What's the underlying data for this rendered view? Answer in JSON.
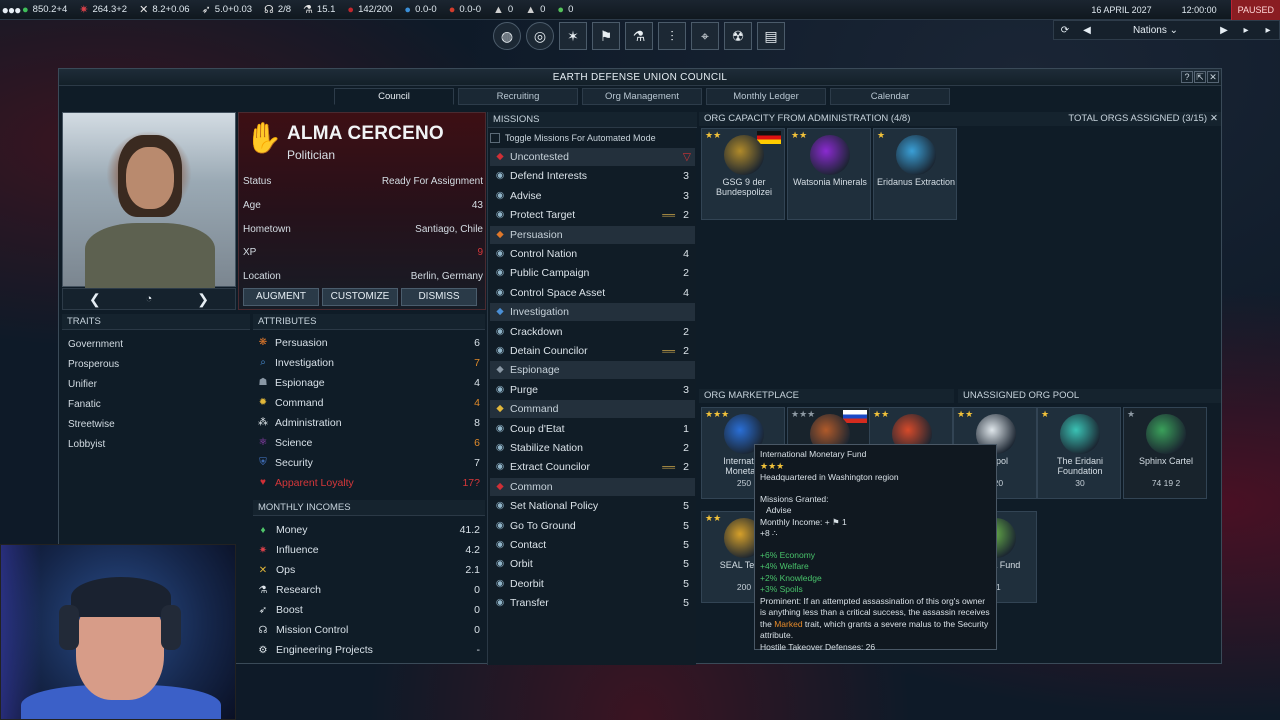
{
  "topbar": {
    "resources": [
      {
        "icon": "money-icon",
        "value": "850.2+4",
        "color": "#3fbf5a"
      },
      {
        "icon": "influence-icon",
        "value": "264.3+2",
        "color": "#d9414a"
      },
      {
        "icon": "ops-icon",
        "value": "8.2+0.06",
        "color": "#e6e6e6"
      },
      {
        "icon": "boost-icon",
        "value": "5.0+0.03",
        "color": "#e6e6e6"
      },
      {
        "icon": "mission-control-icon",
        "value": "2/8",
        "color": "#e6e6e6"
      },
      {
        "icon": "research-icon",
        "value": "15.1",
        "color": "#e6e6e6"
      },
      {
        "icon": "control-points-icon",
        "value": "142/200",
        "color": "#c0272d"
      },
      {
        "icon": "water-icon",
        "value": "0.0-0",
        "color": "#3a8fd8"
      },
      {
        "icon": "volatiles-icon",
        "value": "0.0-0",
        "color": "#d23c2c"
      },
      {
        "icon": "metals-icon",
        "value": "0",
        "color": "#cfcfcf"
      },
      {
        "icon": "noble-metals-icon",
        "value": "0",
        "color": "#cfcfcf"
      },
      {
        "icon": "fissiles-icon",
        "value": "0",
        "color": "#54c25a"
      }
    ],
    "date": "16 APRIL 2027",
    "time": "12:00:00",
    "paused": "PAUSED",
    "nations_select": "Nations"
  },
  "panel": {
    "title": "EARTH DEFENSE UNION COUNCIL",
    "tabs": [
      "Council",
      "Recruiting",
      "Org Management",
      "Monthly Ledger",
      "Calendar"
    ]
  },
  "councilor": {
    "name": "ALMA CERCENO",
    "role": "Politician",
    "info": [
      {
        "label": "Status",
        "value": "Ready For Assignment"
      },
      {
        "label": "Age",
        "value": "43"
      },
      {
        "label": "Hometown",
        "value": "Santiago, Chile"
      },
      {
        "label": "XP",
        "value": "9"
      },
      {
        "label": "Location",
        "value": "Berlin, Germany"
      }
    ],
    "buttons": {
      "augment": "AUGMENT",
      "customize": "CUSTOMIZE",
      "dismiss": "DISMISS"
    }
  },
  "traits": {
    "header": "TRAITS",
    "items": [
      "Government",
      "Prosperous",
      "Unifier",
      "Fanatic",
      "Streetwise",
      "Lobbyist"
    ]
  },
  "attributes": {
    "header": "ATTRIBUTES",
    "items": [
      {
        "name": "Persuasion",
        "value": "6",
        "icon": "persuasion-icon",
        "color": "#e0782a"
      },
      {
        "name": "Investigation",
        "value": "7",
        "icon": "investigation-icon",
        "color": "#4a8fd6"
      },
      {
        "name": "Espionage",
        "value": "4",
        "icon": "espionage-icon",
        "color": "#8a98a5"
      },
      {
        "name": "Command",
        "value": "4",
        "icon": "command-icon",
        "color": "#e2b73a"
      },
      {
        "name": "Administration",
        "value": "8",
        "icon": "administration-icon",
        "color": "#dfe6eb"
      },
      {
        "name": "Science",
        "value": "6",
        "icon": "science-icon",
        "color": "#b44ad6"
      },
      {
        "name": "Security",
        "value": "7",
        "icon": "security-icon",
        "color": "#4a7fd6"
      },
      {
        "name": "Apparent Loyalty",
        "value": "17?",
        "icon": "loyalty-icon",
        "color": "#d12f36"
      }
    ]
  },
  "incomes": {
    "header": "MONTHLY INCOMES",
    "items": [
      {
        "name": "Money",
        "value": "41.2",
        "icon": "money-icon",
        "color": "#4fc46a"
      },
      {
        "name": "Influence",
        "value": "4.2",
        "icon": "influence-icon",
        "color": "#d9414a"
      },
      {
        "name": "Ops",
        "value": "2.1",
        "icon": "ops-icon",
        "color": "#e2b73a"
      },
      {
        "name": "Research",
        "value": "0",
        "icon": "research-icon",
        "color": "#dfe6eb"
      },
      {
        "name": "Boost",
        "value": "0",
        "icon": "boost-icon",
        "color": "#dfe6eb"
      },
      {
        "name": "Mission Control",
        "value": "0",
        "icon": "mission-control-icon",
        "color": "#dfe6eb"
      },
      {
        "name": "Engineering Projects",
        "value": "-",
        "icon": "engineering-icon",
        "color": "#dfe6eb"
      }
    ]
  },
  "missions": {
    "header": "MISSIONS",
    "toggle": "Toggle Missions For Automated Mode",
    "rows": [
      {
        "type": "cat",
        "name": "Uncontested",
        "icon": "uncontested-icon",
        "color": "#d12f36"
      },
      {
        "type": "item",
        "name": "Defend Interests",
        "value": "3",
        "icon": "defend-interests-icon"
      },
      {
        "type": "item",
        "name": "Advise",
        "value": "3",
        "icon": "advise-icon"
      },
      {
        "type": "item",
        "name": "Protect Target",
        "value": "2",
        "icon": "protect-target-icon",
        "extra": "══"
      },
      {
        "type": "cat",
        "name": "Persuasion",
        "icon": "persuasion-icon",
        "color": "#e0782a"
      },
      {
        "type": "item",
        "name": "Control Nation",
        "value": "4",
        "icon": "control-nation-icon"
      },
      {
        "type": "item",
        "name": "Public Campaign",
        "value": "2",
        "icon": "public-campaign-icon"
      },
      {
        "type": "item",
        "name": "Control Space Asset",
        "value": "4",
        "icon": "control-space-asset-icon"
      },
      {
        "type": "cat",
        "name": "Investigation",
        "icon": "investigation-icon",
        "color": "#4a8fd6"
      },
      {
        "type": "item",
        "name": "Crackdown",
        "value": "2",
        "icon": "crackdown-icon"
      },
      {
        "type": "item",
        "name": "Detain Councilor",
        "value": "2",
        "icon": "detain-councilor-icon",
        "extra": "══"
      },
      {
        "type": "cat",
        "name": "Espionage",
        "icon": "espionage-icon",
        "color": "#8a98a5"
      },
      {
        "type": "item",
        "name": "Purge",
        "value": "3",
        "icon": "purge-icon"
      },
      {
        "type": "cat",
        "name": "Command",
        "icon": "command-icon",
        "color": "#e2b73a"
      },
      {
        "type": "item",
        "name": "Coup d'Etat",
        "value": "1",
        "icon": "coup-icon"
      },
      {
        "type": "item",
        "name": "Stabilize Nation",
        "value": "2",
        "icon": "stabilize-nation-icon"
      },
      {
        "type": "item",
        "name": "Extract Councilor",
        "value": "2",
        "icon": "extract-councilor-icon",
        "extra": "══"
      },
      {
        "type": "cat",
        "name": "Common",
        "icon": "common-icon",
        "color": "#d12f36"
      },
      {
        "type": "item",
        "name": "Set National Policy",
        "value": "5",
        "icon": "set-national-policy-icon"
      },
      {
        "type": "item",
        "name": "Go To Ground",
        "value": "5",
        "icon": "go-to-ground-icon"
      },
      {
        "type": "item",
        "name": "Contact",
        "value": "5",
        "icon": "contact-icon"
      },
      {
        "type": "item",
        "name": "Orbit",
        "value": "5",
        "icon": "orbit-icon"
      },
      {
        "type": "item",
        "name": "Deorbit",
        "value": "5",
        "icon": "deorbit-icon"
      },
      {
        "type": "item",
        "name": "Transfer",
        "value": "5",
        "icon": "transfer-icon"
      }
    ]
  },
  "orgs": {
    "capacity_header": "ORG CAPACITY FROM ADMINISTRATION (4/8)",
    "total_header": "TOTAL ORGS ASSIGNED (3/15)",
    "assigned": [
      {
        "name": "GSG 9 der Bundespolizei",
        "stars": "★★",
        "logo_color": "#b08a2a",
        "flag": "germany"
      },
      {
        "name": "Watsonia Minerals",
        "stars": "★★",
        "logo_color": "#8a2ad0"
      },
      {
        "name": "Eridanus Extraction",
        "stars": "★",
        "logo_color": "#3a9fd6"
      }
    ],
    "marketplace_header": "ORG MARKETPLACE",
    "pool_header": "UNASSIGNED ORG POOL",
    "marketplace": [
      {
        "name": "International Monetary Fund",
        "short": "Internati… Monetary",
        "sub": "250",
        "stars": "★★★",
        "logo_color": "#2a6fd6"
      },
      {
        "name": "",
        "stars": "★★★",
        "logo_color": "#b05a2a",
        "sub": "",
        "flag": "russia",
        "gray": true
      },
      {
        "name": "",
        "stars": "★★",
        "logo_color": "#d64a2a",
        "sub": ""
      },
      {
        "name": "Europol",
        "short": "…rpol",
        "sub": "120",
        "stars": "★★",
        "logo_color": "#dfe6eb"
      },
      {
        "name": "SEAL Team",
        "short": "SEAL Tea…",
        "sub": "200",
        "stars": "★★",
        "logo_color": "#d6a02a"
      },
      {
        "name": "",
        "short": "…esia Fund",
        "sub": "31",
        "stars": "",
        "logo_color": "#6ab64a"
      }
    ],
    "pool": [
      {
        "name": "The Eridani Foundation",
        "sub": "30",
        "stars": "★",
        "logo_color": "#3ac2b4"
      },
      {
        "name": "Sphinx Cartel",
        "sub": "74  19  2",
        "stars": "★",
        "logo_color": "#3aa05a",
        "gray": true
      }
    ]
  },
  "tooltip": {
    "title": "International Monetary Fund",
    "stars": "★★★",
    "hq": "Headquartered in Washington region",
    "missions_label": "Missions Granted:",
    "mission": "Advise",
    "income": "Monthly Income: + ⚑ 1",
    "income2": "+8 ∴",
    "effects": [
      "+6% Economy",
      "+4% Welfare",
      "+2% Knowledge",
      "+3% Spoils"
    ],
    "prominent_a": "Prominent: If an attempted assassination of this org's owner is anything less than a critical success, the assassin receives the",
    "prominent_marked": "Marked",
    "prominent_b": "trait, which grants a severe malus to the Security attribute.",
    "defenses": "Hostile Takeover Defenses: 26"
  }
}
